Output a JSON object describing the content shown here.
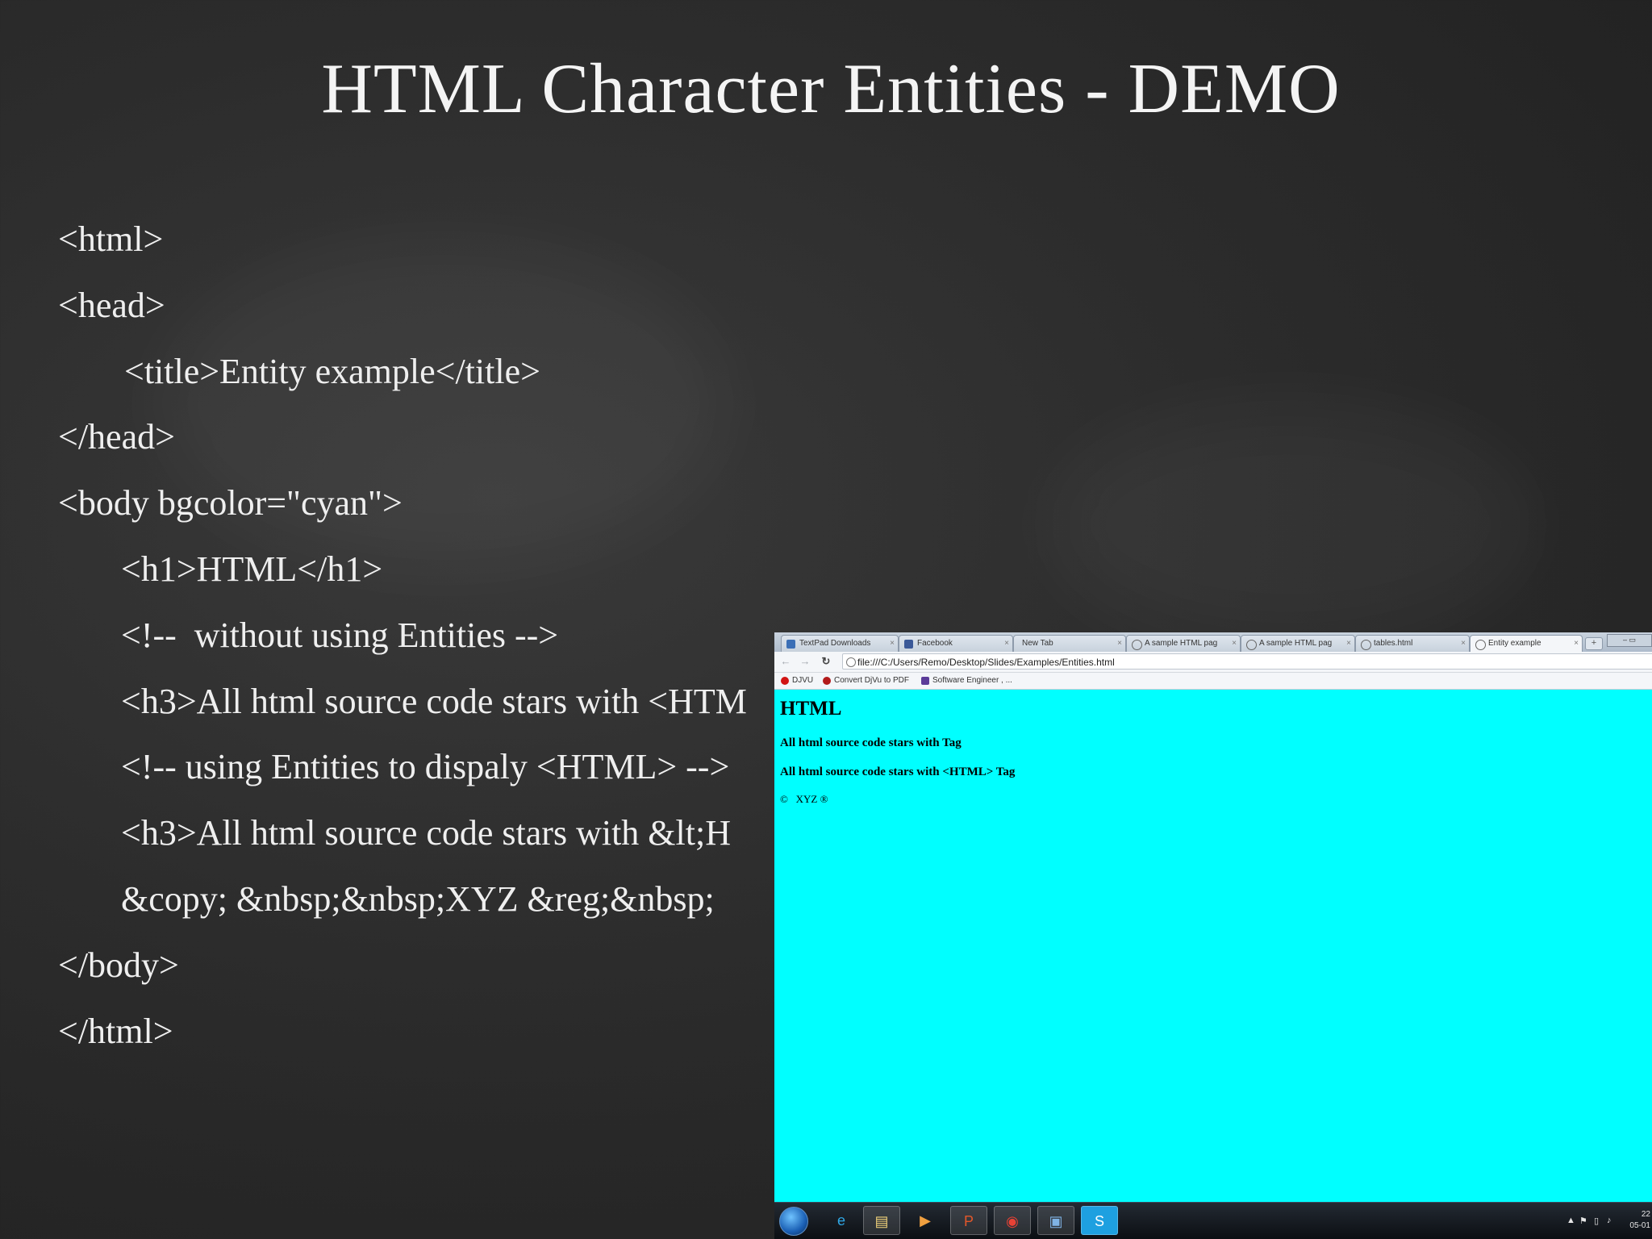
{
  "slide": {
    "title": "HTML Character Entities  - DEMO",
    "code_lines": [
      "<html>",
      "<head>",
      "<title>Entity example</title>",
      "</head>",
      "<body bgcolor=\"cyan\">",
      "<h1>HTML</h1>",
      "<!--  without using Entities -->",
      "<h3>All html source code stars with <HTM",
      "<!-- using Entities to dispaly <HTML> -->",
      "<h3>All html source code stars with &lt;H",
      "&copy; &nbsp;&nbsp;XYZ &reg;&nbsp;",
      "</body>",
      "</html>"
    ]
  },
  "browser": {
    "tabs": [
      {
        "label": "TextPad Downloads",
        "icon": "textpad-icon"
      },
      {
        "label": "Facebook",
        "icon": "facebook-icon"
      },
      {
        "label": "New Tab",
        "icon": ""
      },
      {
        "label": "A sample HTML pag",
        "icon": "page-icon"
      },
      {
        "label": "A sample HTML pag",
        "icon": "page-icon"
      },
      {
        "label": "tables.html",
        "icon": "page-icon"
      },
      {
        "label": "Entity example",
        "icon": "page-icon"
      }
    ],
    "active_tab": "Entity example",
    "address": "file:///C:/Users/Remo/Desktop/Slides/Examples/Entities.html",
    "bookmarks": [
      {
        "label": "DJVU",
        "icon": "djvu-icon",
        "color": "#d21414"
      },
      {
        "label": "Convert DjVu to PDF",
        "icon": "convert-icon",
        "color": "#b31b1b"
      },
      {
        "label": "Software Engineer , ...",
        "icon": "monster-icon",
        "color": "#5b3c99"
      }
    ],
    "page": {
      "background": "#00ffff",
      "h1": "HTML",
      "h3_without_entities": "All html source code stars with Tag",
      "h3_with_entities": "All html source code stars with <HTML> Tag",
      "footer": "©   XYZ ®"
    }
  },
  "taskbar": {
    "apps": [
      "internet-explorer-icon",
      "file-explorer-icon",
      "media-player-icon",
      "powerpoint-icon",
      "chrome-icon",
      "remote-desktop-icon",
      "skype-icon"
    ],
    "clock_time": "22",
    "clock_date": "05-01"
  }
}
